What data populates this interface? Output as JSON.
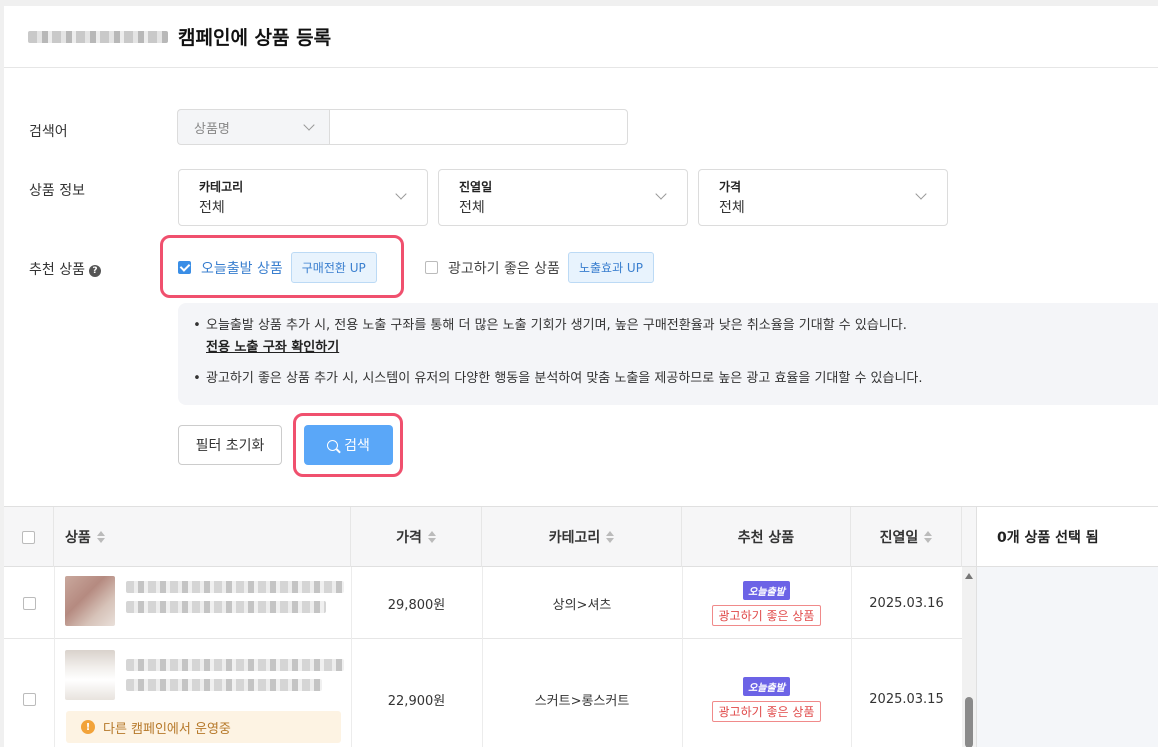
{
  "header": {
    "title": "캠페인에 상품 등록"
  },
  "filters": {
    "keyword_label": "검색어",
    "keyword_type": "상품명",
    "keyword_value": "",
    "product_info_label": "상품 정보",
    "dropdowns": [
      {
        "title": "카테고리",
        "value": "전체"
      },
      {
        "title": "진열일",
        "value": "전체"
      },
      {
        "title": "가격",
        "value": "전체"
      }
    ],
    "recommend_label": "추천 상품",
    "recommend_options": [
      {
        "label": "오늘출발 상품",
        "tag": "구매전환 UP",
        "checked": true
      },
      {
        "label": "광고하기 좋은 상품",
        "tag": "노출효과 UP",
        "checked": false
      }
    ],
    "info": {
      "line1": "오늘출발 상품 추가 시, 전용 노출 구좌를 통해 더 많은 노출 기회가 생기며, 높은 구매전환율과 낮은 취소율을 기대할 수 있습니다.",
      "link": "전용 노출 구좌 확인하기",
      "line2": "광고하기 좋은 상품 추가 시, 시스템이 유저의 다양한 행동을 분석하여 맞춤 노출을 제공하므로 높은 광고 효율을 기대할 수 있습니다."
    },
    "reset_label": "필터 초기화",
    "search_label": "검색"
  },
  "table": {
    "columns": [
      "상품",
      "가격",
      "카테고리",
      "추천 상품",
      "진열일"
    ],
    "rows": [
      {
        "price": "29,800원",
        "category": "상의>셔츠",
        "badge_today": "오늘출발",
        "badge_ad": "광고하기 좋은 상품",
        "date": "2025.03.16",
        "notice": ""
      },
      {
        "price": "22,900원",
        "category": "스커트>롱스커트",
        "badge_today": "오늘출발",
        "badge_ad": "광고하기 좋은 상품",
        "date": "2025.03.15",
        "notice": "다른 캠페인에서 운영중"
      }
    ]
  },
  "side_panel": {
    "selected_text": "0개 상품 선택 됨"
  },
  "colors": {
    "accent": "#5aa7f8",
    "highlight": "#f0506e",
    "today_badge": "#6c63e6",
    "ad_badge": "#e04a4a"
  }
}
